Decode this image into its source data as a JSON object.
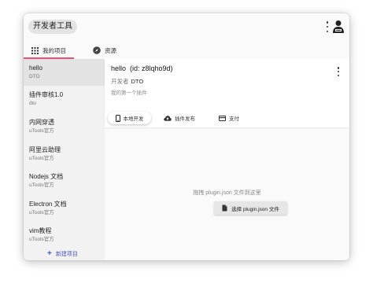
{
  "app": {
    "title": "开发者工具"
  },
  "tabs": [
    {
      "label": "我的项目",
      "icon": "grid-icon"
    },
    {
      "label": "资源",
      "icon": "compass-icon"
    }
  ],
  "sidebar": {
    "items": [
      {
        "name": "hello",
        "sub": "DTO"
      },
      {
        "name": "插件审核1.0",
        "sub": "dto"
      },
      {
        "name": "内网穿透",
        "sub": "uTools官方"
      },
      {
        "name": "阿里云助理",
        "sub": "uTools官方"
      },
      {
        "name": "Nodejs 文档",
        "sub": "uTools官方"
      },
      {
        "name": "Electron 文档",
        "sub": "uTools官方"
      },
      {
        "name": "vim教程",
        "sub": "uTools官方"
      }
    ],
    "new_project_label": "新建项目"
  },
  "plugin": {
    "name": "hello",
    "id_text": "(id: z8lqho9d)",
    "developer_label": "开发者",
    "developer_name": "DTO",
    "description": "我的第一个插件"
  },
  "sub_tabs": [
    {
      "label": "本地开发",
      "icon": "phone-icon"
    },
    {
      "label": "插件发布",
      "icon": "cloud-upload-icon"
    },
    {
      "label": "支付",
      "icon": "credit-card-icon"
    }
  ],
  "dropzone": {
    "hint": "拖拽 plugin.json 文件到这里",
    "button_label": "选择 plugin.json 文件"
  },
  "colors": {
    "accent_pink": "#ea4f7a",
    "link_blue": "#4a54c8"
  }
}
